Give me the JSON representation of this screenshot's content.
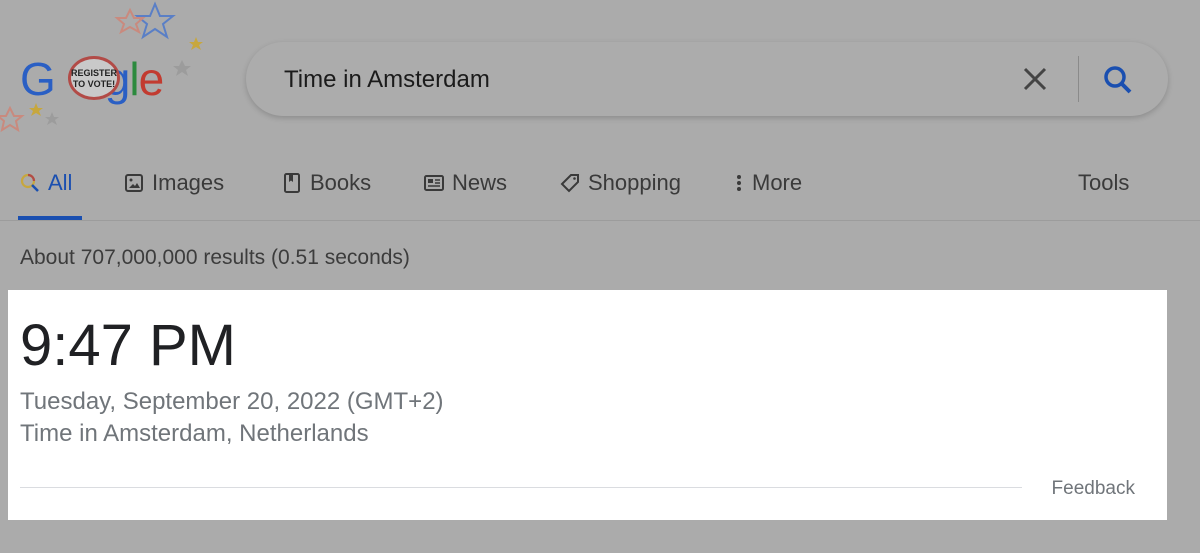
{
  "logo": {
    "text_left": "G",
    "text_right": "gle",
    "badge": "REGISTER TO VOTE!"
  },
  "search": {
    "query": "Time in Amsterdam"
  },
  "tabs": [
    {
      "label": "All",
      "icon": "search-multicolor-icon"
    },
    {
      "label": "Images",
      "icon": "image-icon"
    },
    {
      "label": "Books",
      "icon": "book-icon"
    },
    {
      "label": "News",
      "icon": "newspaper-icon"
    },
    {
      "label": "Shopping",
      "icon": "tag-icon"
    },
    {
      "label": "More",
      "icon": "more-vert-icon"
    }
  ],
  "tools": "Tools",
  "stats": "About 707,000,000 results (0.51 seconds)",
  "result": {
    "time": "9:47 PM",
    "date": "Tuesday, September 20, 2022 (GMT+2)",
    "place": "Time in Amsterdam, Netherlands",
    "feedback": "Feedback"
  },
  "colors": {
    "accent": "#1a4fb0",
    "overlay": "#ababab"
  }
}
